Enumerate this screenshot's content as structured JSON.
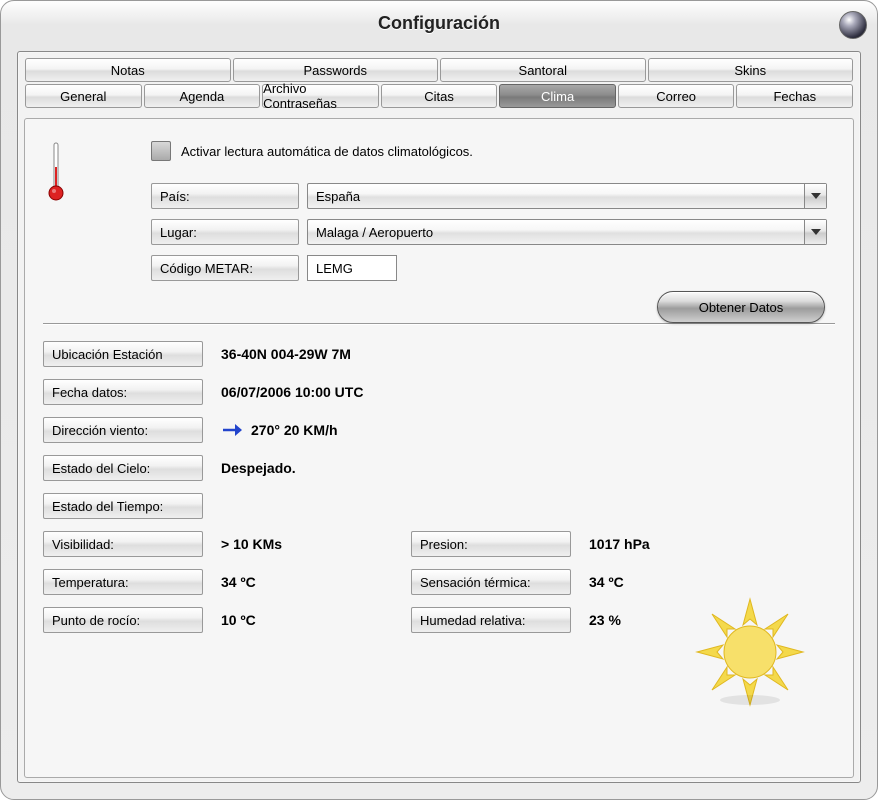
{
  "window": {
    "title": "Configuración"
  },
  "tabs_top": [
    "Notas",
    "Passwords",
    "Santoral",
    "Skins"
  ],
  "tabs_bottom": [
    "General",
    "Agenda",
    "Archivo Contraseñas",
    "Citas",
    "Clima",
    "Correo",
    "Fechas"
  ],
  "selected_tab": "Clima",
  "checkbox": {
    "label": "Activar lectura automática de datos climatológicos."
  },
  "form": {
    "country_label": "País:",
    "country_value": "España",
    "place_label": "Lugar:",
    "place_value": "Malaga / Aeropuerto",
    "metar_label": "Código METAR:",
    "metar_value": "LEMG"
  },
  "buttons": {
    "get_data": "Obtener Datos"
  },
  "fields": {
    "station_loc_label": "Ubicación Estación",
    "station_loc_value": "36-40N 004-29W 7M",
    "date_label": "Fecha datos:",
    "date_value": "06/07/2006 10:00 UTC",
    "wind_dir_label": "Dirección viento:",
    "wind_dir_value": "270°  20 KM/h",
    "sky_label": "Estado del Cielo:",
    "sky_value": "Despejado.",
    "weather_state_label": "Estado del Tiempo:",
    "weather_state_value": "",
    "visibility_label": "Visibilidad:",
    "visibility_value": "> 10 KMs",
    "pressure_label": "Presion:",
    "pressure_value": "1017 hPa",
    "temperature_label": "Temperatura:",
    "temperature_value": "34 ºC",
    "feels_label": "Sensación térmica:",
    "feels_value": "34 ºC",
    "dew_label": "Punto de rocío:",
    "dew_value": "10 ºC",
    "humidity_label": "Humedad relativa:",
    "humidity_value": "23 %"
  }
}
